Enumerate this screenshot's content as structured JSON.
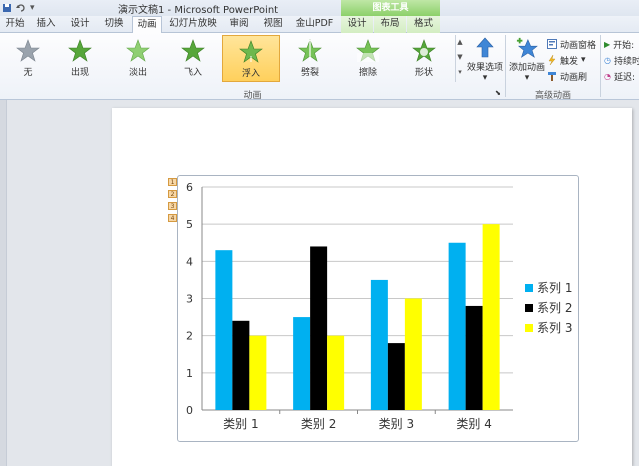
{
  "title_bar": {
    "qat_icons": [
      "save-icon",
      "undo-icon",
      "customize-qat-icon"
    ],
    "title": "演示文稿1 - Microsoft PowerPoint",
    "context_tab_header": "图表工具"
  },
  "tabs": [
    {
      "label": "开始"
    },
    {
      "label": "插入"
    },
    {
      "label": "设计"
    },
    {
      "label": "切换"
    },
    {
      "label": "动画",
      "active": true
    },
    {
      "label": "幻灯片放映"
    },
    {
      "label": "审阅"
    },
    {
      "label": "视图"
    },
    {
      "label": "金山PDF"
    },
    {
      "label": "设计",
      "context": true
    },
    {
      "label": "布局",
      "context": true
    },
    {
      "label": "格式",
      "context": true
    }
  ],
  "ribbon": {
    "animations": [
      {
        "label": "无",
        "icon": "star-none-icon",
        "color": "#9aa3ad"
      },
      {
        "label": "出现",
        "icon": "star-appear-icon",
        "color": "#56a63a"
      },
      {
        "label": "淡出",
        "icon": "star-fade-icon",
        "color": "#8fcf72"
      },
      {
        "label": "飞入",
        "icon": "star-flyin-icon",
        "color": "#56a63a"
      },
      {
        "label": "浮入",
        "icon": "star-floatin-icon",
        "color": "#6fb84d",
        "selected": true
      },
      {
        "label": "劈裂",
        "icon": "star-split-icon",
        "color": "#76c257"
      },
      {
        "label": "擦除",
        "icon": "star-wipe-icon",
        "color": "#76c257"
      },
      {
        "label": "形状",
        "icon": "star-shape-icon",
        "color": "#56a63a"
      }
    ],
    "effect_options": "效果选项",
    "animation_group_label": "动画",
    "add_animation": "添加动画",
    "animation_pane": "动画窗格",
    "trigger": "触发",
    "animation_painter": "动画刷",
    "advanced_group_label": "高级动画",
    "start": "开始:",
    "duration": "持续时",
    "delay": "延迟:"
  },
  "badges": [
    "1",
    "2",
    "3",
    "4"
  ],
  "chart_data": {
    "type": "bar",
    "categories": [
      "类别 1",
      "类别 2",
      "类别 3",
      "类别 4"
    ],
    "series": [
      {
        "name": "系列 1",
        "values": [
          4.3,
          2.5,
          3.5,
          4.5
        ],
        "color": "#00b0f0"
      },
      {
        "name": "系列 2",
        "values": [
          2.4,
          4.4,
          1.8,
          2.8
        ],
        "color": "#000000"
      },
      {
        "name": "系列 3",
        "values": [
          2,
          2,
          3,
          5
        ],
        "color": "#ffff00"
      }
    ],
    "ylim": [
      0,
      6
    ],
    "yticks": [
      "0",
      "1",
      "2",
      "3",
      "4",
      "5",
      "6"
    ],
    "grid": true,
    "legend_position": "right"
  }
}
